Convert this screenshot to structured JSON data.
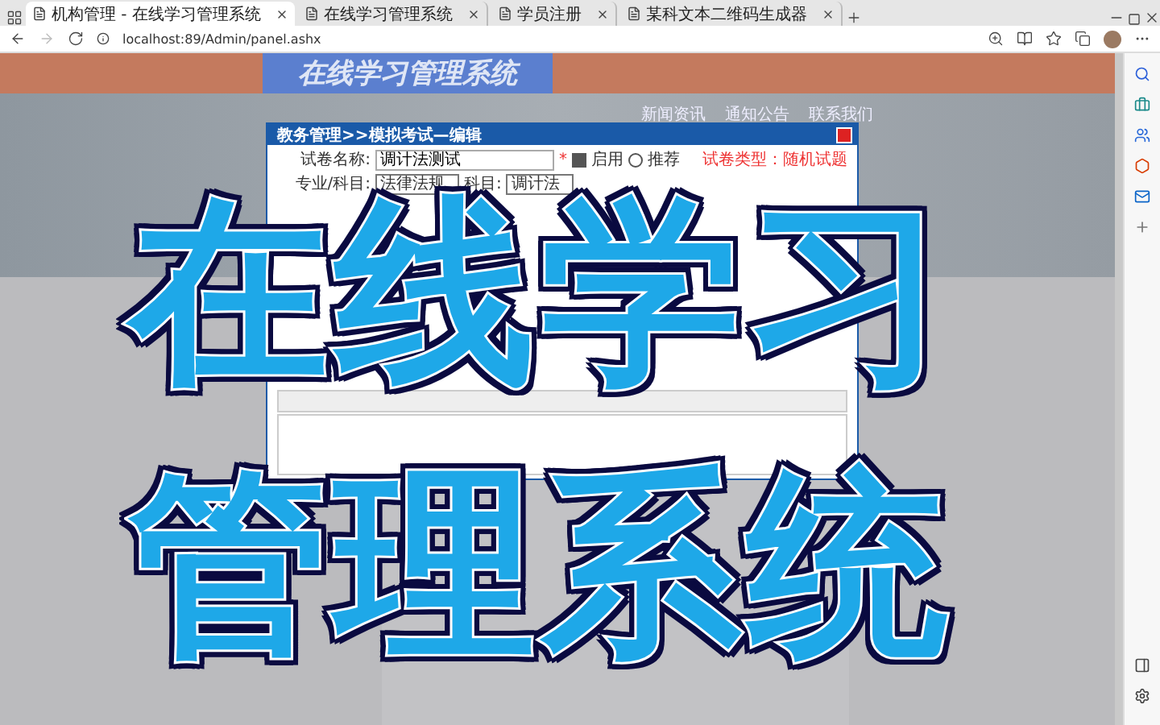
{
  "browser": {
    "tabs": [
      {
        "title": "机构管理 - 在线学习管理系统",
        "selected": true
      },
      {
        "title": "在线学习管理系统",
        "selected": false
      },
      {
        "title": "学员注册",
        "selected": false
      },
      {
        "title": "某科文本二维码生成器",
        "selected": false
      }
    ],
    "url": "localhost:89/Admin/panel.ashx"
  },
  "page": {
    "site_title": "在线学习管理系统",
    "nav_links": [
      "新闻资讯",
      "通知公告",
      "联系我们"
    ],
    "dialog": {
      "title": "教务管理>>模拟考试—编辑",
      "name_label": "试卷名称:",
      "name_value": "调计法测试",
      "required_mark": "*",
      "enabled": {
        "label": "启用",
        "checked": true
      },
      "recommend": {
        "label": "推荐",
        "selected": false
      },
      "type_label": "试卷类型：随机试题",
      "subject_label": "专业/科目:",
      "subject_value": "法律法规",
      "course_label": "科目:",
      "course_value": "调计法"
    }
  },
  "overlay": {
    "lines": [
      "在线学习",
      "管理系统"
    ]
  }
}
